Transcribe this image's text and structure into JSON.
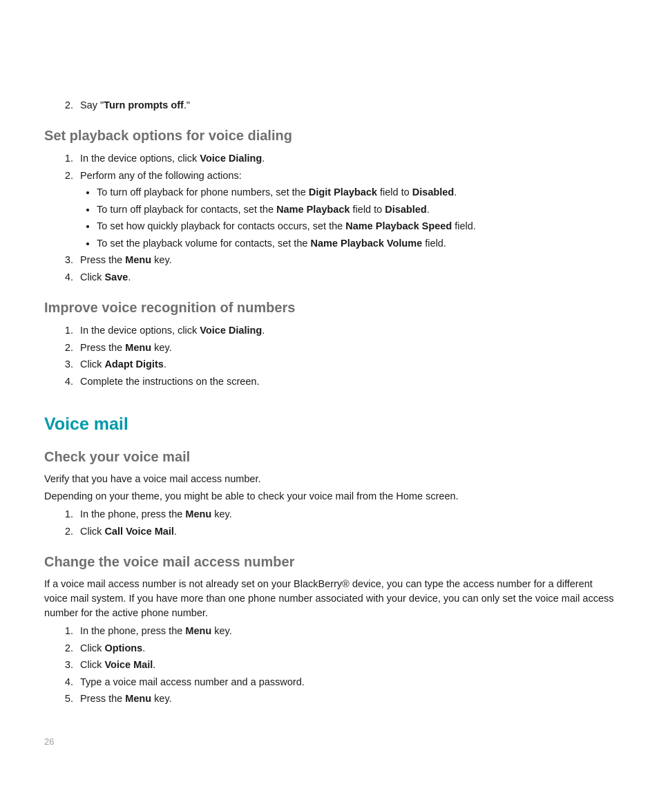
{
  "top_step2": {
    "prefix": "Say \"",
    "bold": "Turn prompts off",
    "suffix": ".\""
  },
  "section_playback": {
    "heading": "Set playback options for voice dialing",
    "step1_a": "In the device options, click ",
    "step1_b": "Voice Dialing",
    "step1_c": ".",
    "step2": "Perform any of the following actions:",
    "bullets": {
      "b1_a": "To turn off playback for phone numbers, set the ",
      "b1_b": "Digit Playback",
      "b1_c": " field to ",
      "b1_d": "Disabled",
      "b1_e": ".",
      "b2_a": "To turn off playback for contacts, set the ",
      "b2_b": "Name Playback",
      "b2_c": " field to ",
      "b2_d": "Disabled",
      "b2_e": ".",
      "b3_a": "To set how quickly playback for contacts occurs, set the ",
      "b3_b": "Name Playback Speed",
      "b3_c": " field.",
      "b4_a": "To set the playback volume for contacts, set the ",
      "b4_b": "Name Playback Volume",
      "b4_c": " field."
    },
    "step3_a": "Press the ",
    "step3_b": "Menu",
    "step3_c": " key.",
    "step4_a": "Click ",
    "step4_b": "Save",
    "step4_c": "."
  },
  "section_improve": {
    "heading": "Improve voice recognition of numbers",
    "step1_a": "In the device options, click ",
    "step1_b": "Voice Dialing",
    "step1_c": ".",
    "step2_a": "Press the ",
    "step2_b": "Menu",
    "step2_c": " key.",
    "step3_a": "Click ",
    "step3_b": "Adapt Digits",
    "step3_c": ".",
    "step4": "Complete the instructions on the screen."
  },
  "major_heading": "Voice mail",
  "section_check": {
    "heading": "Check your voice mail",
    "para1": "Verify that you have a voice mail access number.",
    "para2": "Depending on your theme, you might be able to check your voice mail from the Home screen.",
    "step1_a": "In the phone, press the ",
    "step1_b": "Menu",
    "step1_c": " key.",
    "step2_a": "Click ",
    "step2_b": "Call Voice Mail",
    "step2_c": "."
  },
  "section_change": {
    "heading": "Change the voice mail access number",
    "para": "If a voice mail access number is not already set on your BlackBerry® device, you can type the access number for a different voice mail system. If you have more than one phone number associated with your device, you can only set the voice mail access number for the active phone number.",
    "step1_a": "In the phone, press the ",
    "step1_b": "Menu",
    "step1_c": " key.",
    "step2_a": "Click ",
    "step2_b": "Options",
    "step2_c": ".",
    "step3_a": "Click ",
    "step3_b": "Voice Mail",
    "step3_c": ".",
    "step4": "Type a voice mail access number and a password.",
    "step5_a": "Press the ",
    "step5_b": "Menu",
    "step5_c": " key."
  },
  "page_number": "26"
}
